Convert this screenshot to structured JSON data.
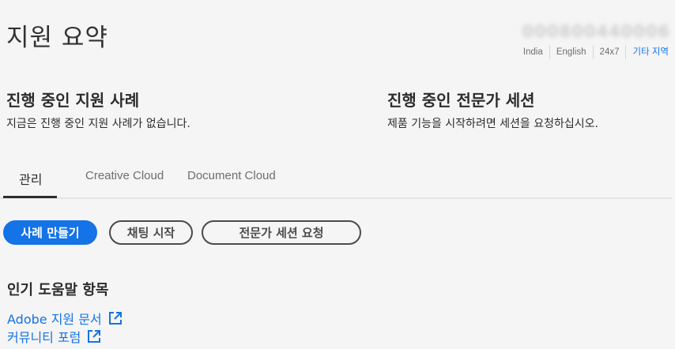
{
  "header": {
    "title": "지원 요약",
    "phone": "000800440006",
    "region": [
      "India",
      "English",
      "24x7",
      "기타 지역"
    ]
  },
  "cases": {
    "heading": "진행 중인 지원 사례",
    "text": "지금은 진행 중인 지원 사례가 없습니다."
  },
  "sessions": {
    "heading": "진행 중인 전문가 세션",
    "text": "제품 기능을 시작하려면 세션을 요청하십시오."
  },
  "tabs": [
    {
      "label": "관리",
      "active": true
    },
    {
      "label": "Creative Cloud",
      "active": false
    },
    {
      "label": "Document Cloud",
      "active": false
    }
  ],
  "actions": {
    "create_case": "사례 만들기",
    "start_chat": "채팅 시작",
    "request_session": "전문가 세션 요청"
  },
  "help": {
    "title": "인기 도움말 항목",
    "links": [
      {
        "label": "Adobe 지원 문서",
        "icon": "external-link-icon"
      },
      {
        "label": "커뮤니티 포럼",
        "icon": "external-link-icon"
      }
    ]
  },
  "colors": {
    "accent": "#1473e6",
    "background": "#f5f5f5",
    "text": "#2c2c2c"
  }
}
